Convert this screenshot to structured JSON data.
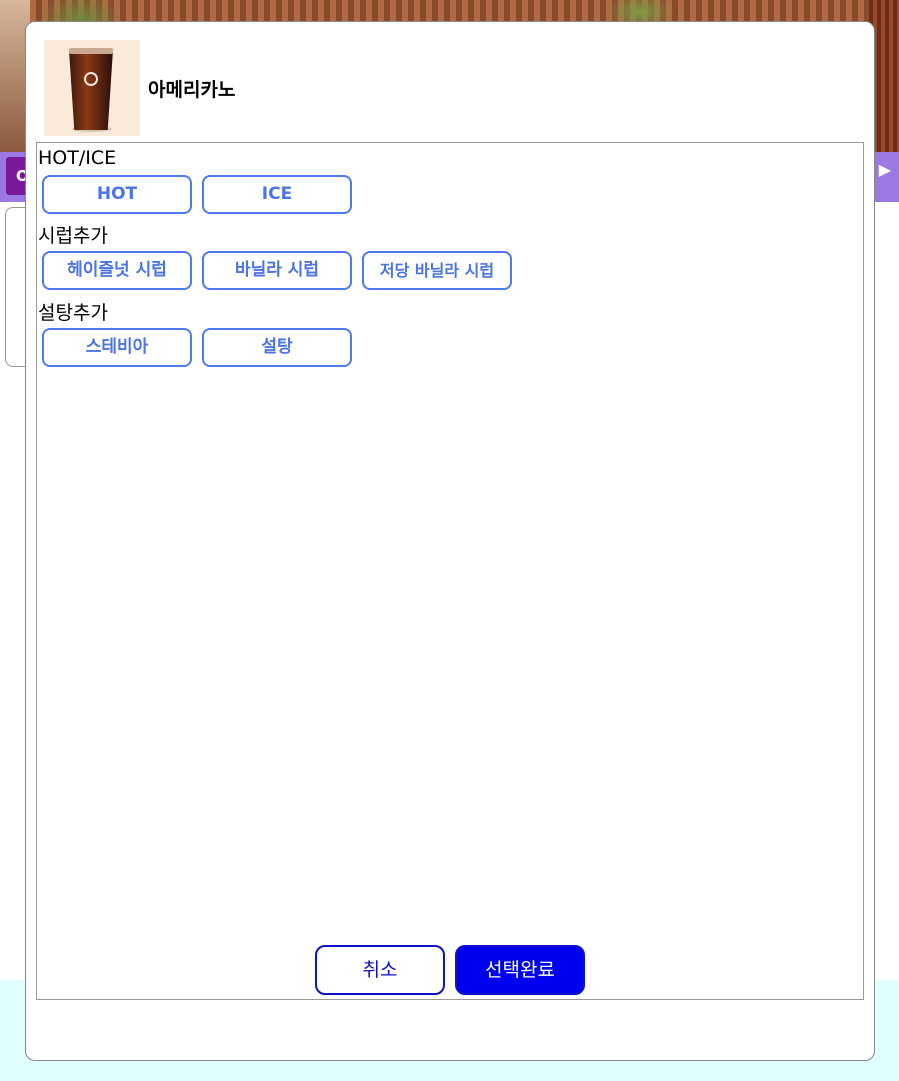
{
  "background": {
    "nav_tab_label": "O",
    "nav_arrow": "▶"
  },
  "modal": {
    "product": {
      "name": "아메리카노",
      "image_icon": "iced-americano-cup"
    },
    "option_groups": [
      {
        "title": "HOT/ICE",
        "options": [
          "HOT",
          "ICE"
        ]
      },
      {
        "title": "시럽추가",
        "options": [
          "헤이즐넛 시럽",
          "바닐라 시럽",
          "저당 바닐라 시럽"
        ]
      },
      {
        "title": "설탕추가",
        "options": [
          "스테비아",
          "설탕"
        ]
      }
    ],
    "buttons": {
      "cancel": "취소",
      "confirm": "선택완료"
    },
    "colors": {
      "option_border": "#5079ee",
      "option_text": "#4a74e8",
      "confirm_bg": "#0000f0",
      "cancel_border": "#1010c8",
      "nav_bar": "#9a7ae0"
    }
  }
}
